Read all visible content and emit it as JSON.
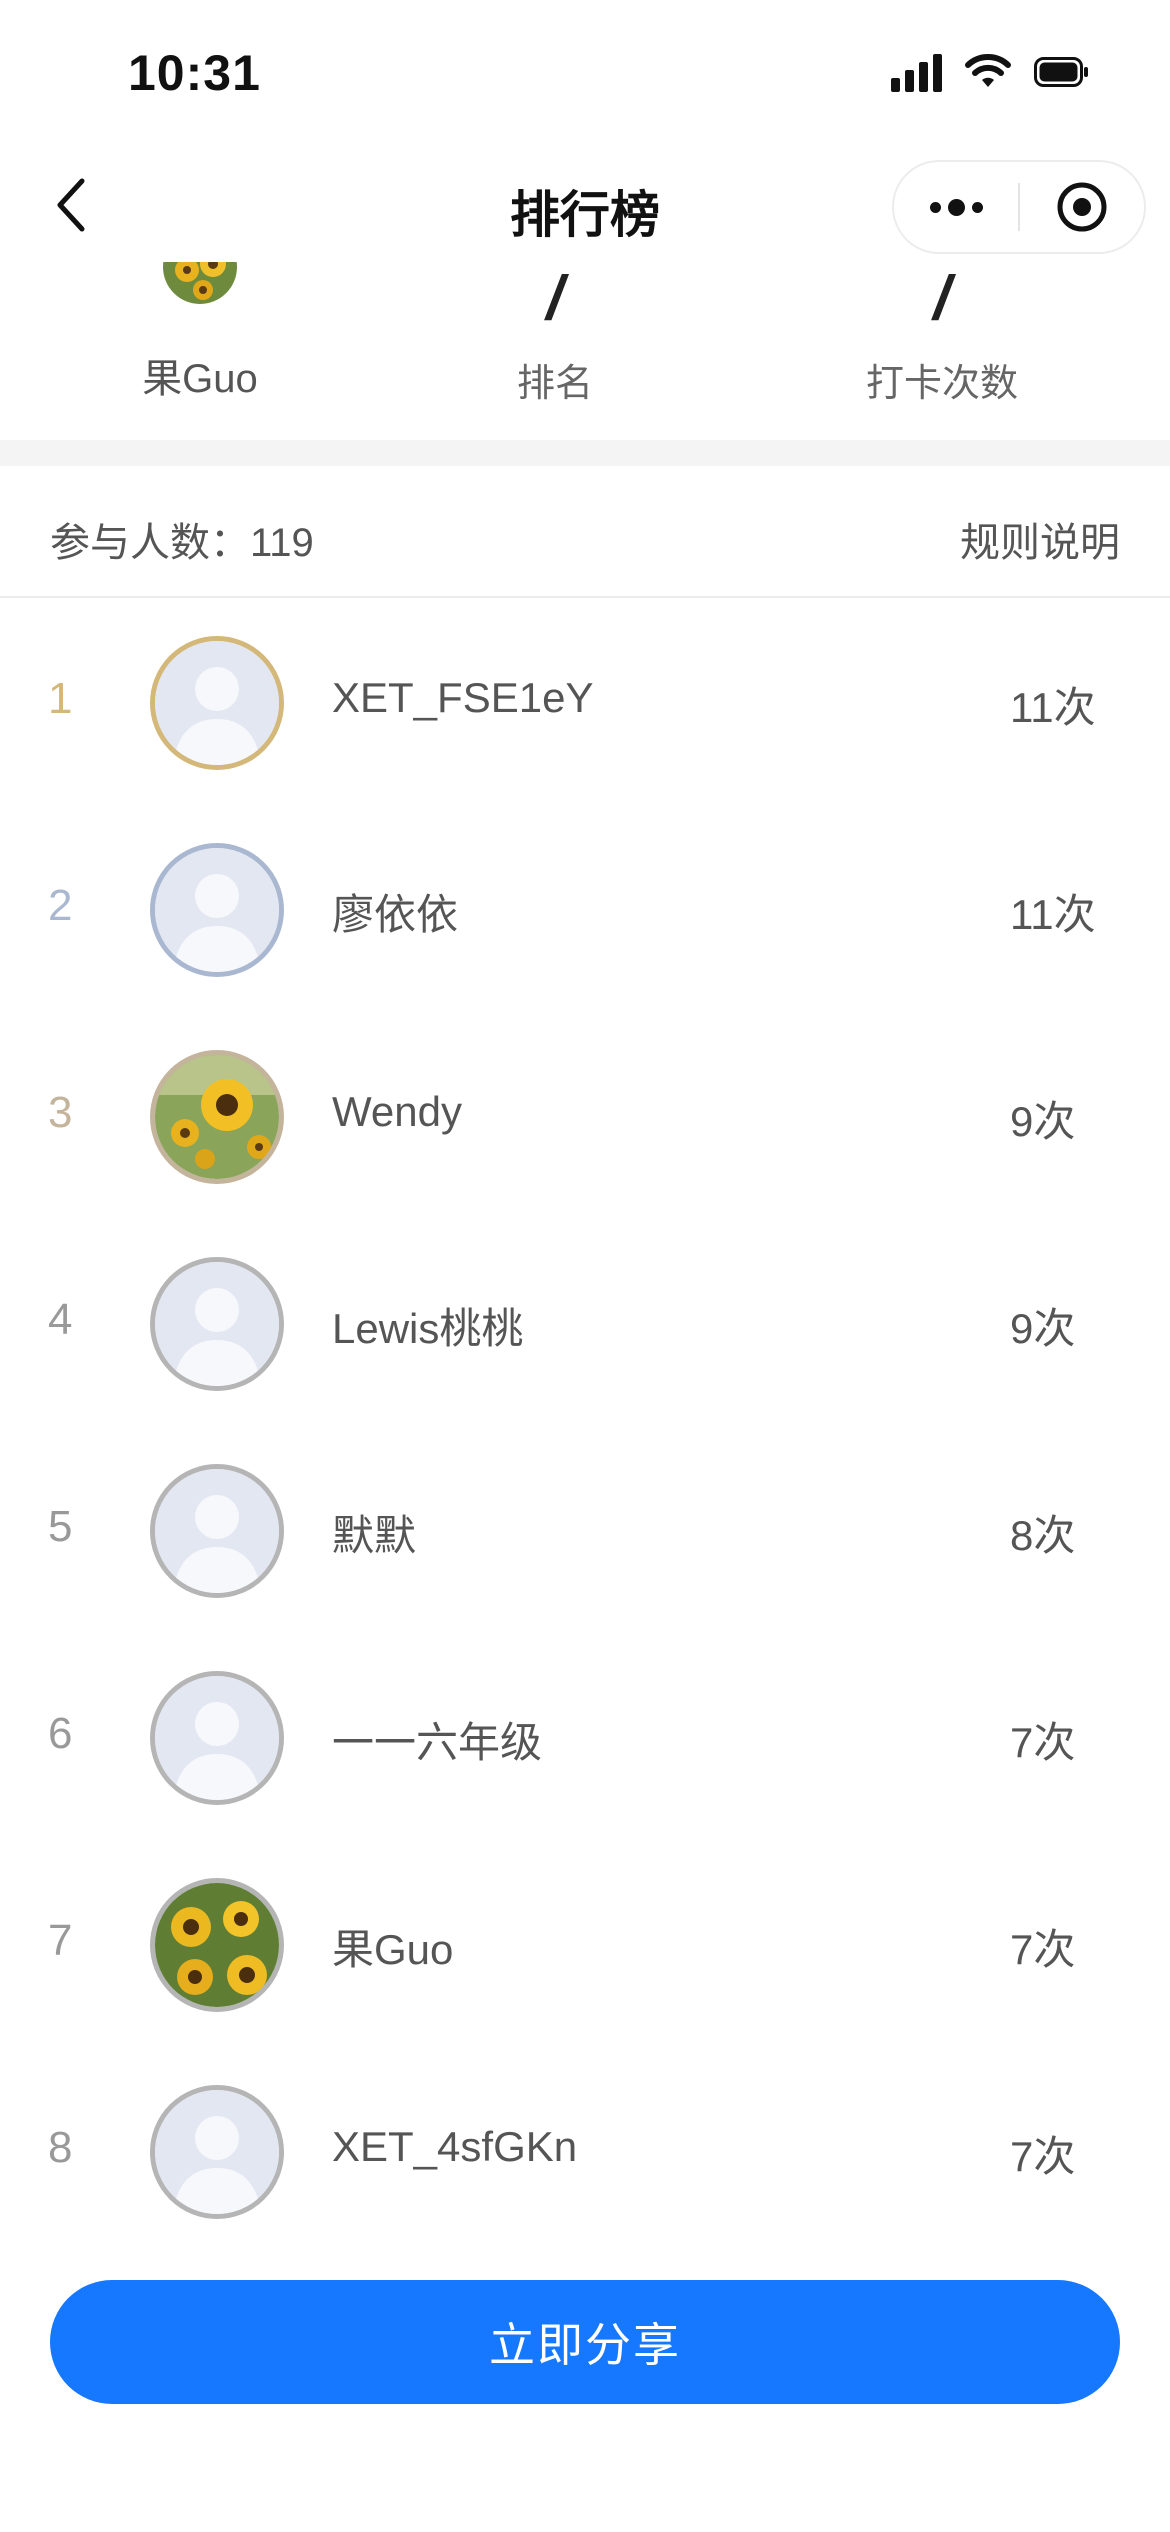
{
  "status_bar": {
    "time": "10:31"
  },
  "nav": {
    "title": "排行榜"
  },
  "my_stats": {
    "name": "果Guo",
    "rank_value": "/",
    "rank_label": "排名",
    "checkin_value": "/",
    "checkin_label": "打卡次数"
  },
  "participants": {
    "label": "参与人数：119",
    "rules": "规则说明"
  },
  "accent_colors": {
    "gold": "#d4b879",
    "silver": "#a9b8d0",
    "bronze": "#c4b49c",
    "default": "#b5b5b5",
    "primary": "#1677ff"
  },
  "rankings": [
    {
      "rank": "1",
      "name": "XET_FSE1eY",
      "count": "11次",
      "avatar": "default-avatar"
    },
    {
      "rank": "2",
      "name": "廖依依",
      "count": "11次",
      "avatar": "default-avatar"
    },
    {
      "rank": "3",
      "name": "Wendy",
      "count": "9次",
      "avatar": "sunflower-photo"
    },
    {
      "rank": "4",
      "name": "Lewis桃桃",
      "count": "9次",
      "avatar": "default-avatar"
    },
    {
      "rank": "5",
      "name": "默默",
      "count": "8次",
      "avatar": "default-avatar"
    },
    {
      "rank": "6",
      "name": "一一六年级",
      "count": "7次",
      "avatar": "default-avatar"
    },
    {
      "rank": "7",
      "name": "果Guo",
      "count": "7次",
      "avatar": "sunflower-photo"
    },
    {
      "rank": "8",
      "name": "XET_4sfGKn",
      "count": "7次",
      "avatar": "default-avatar"
    }
  ],
  "share_button": {
    "label": "立即分享"
  }
}
